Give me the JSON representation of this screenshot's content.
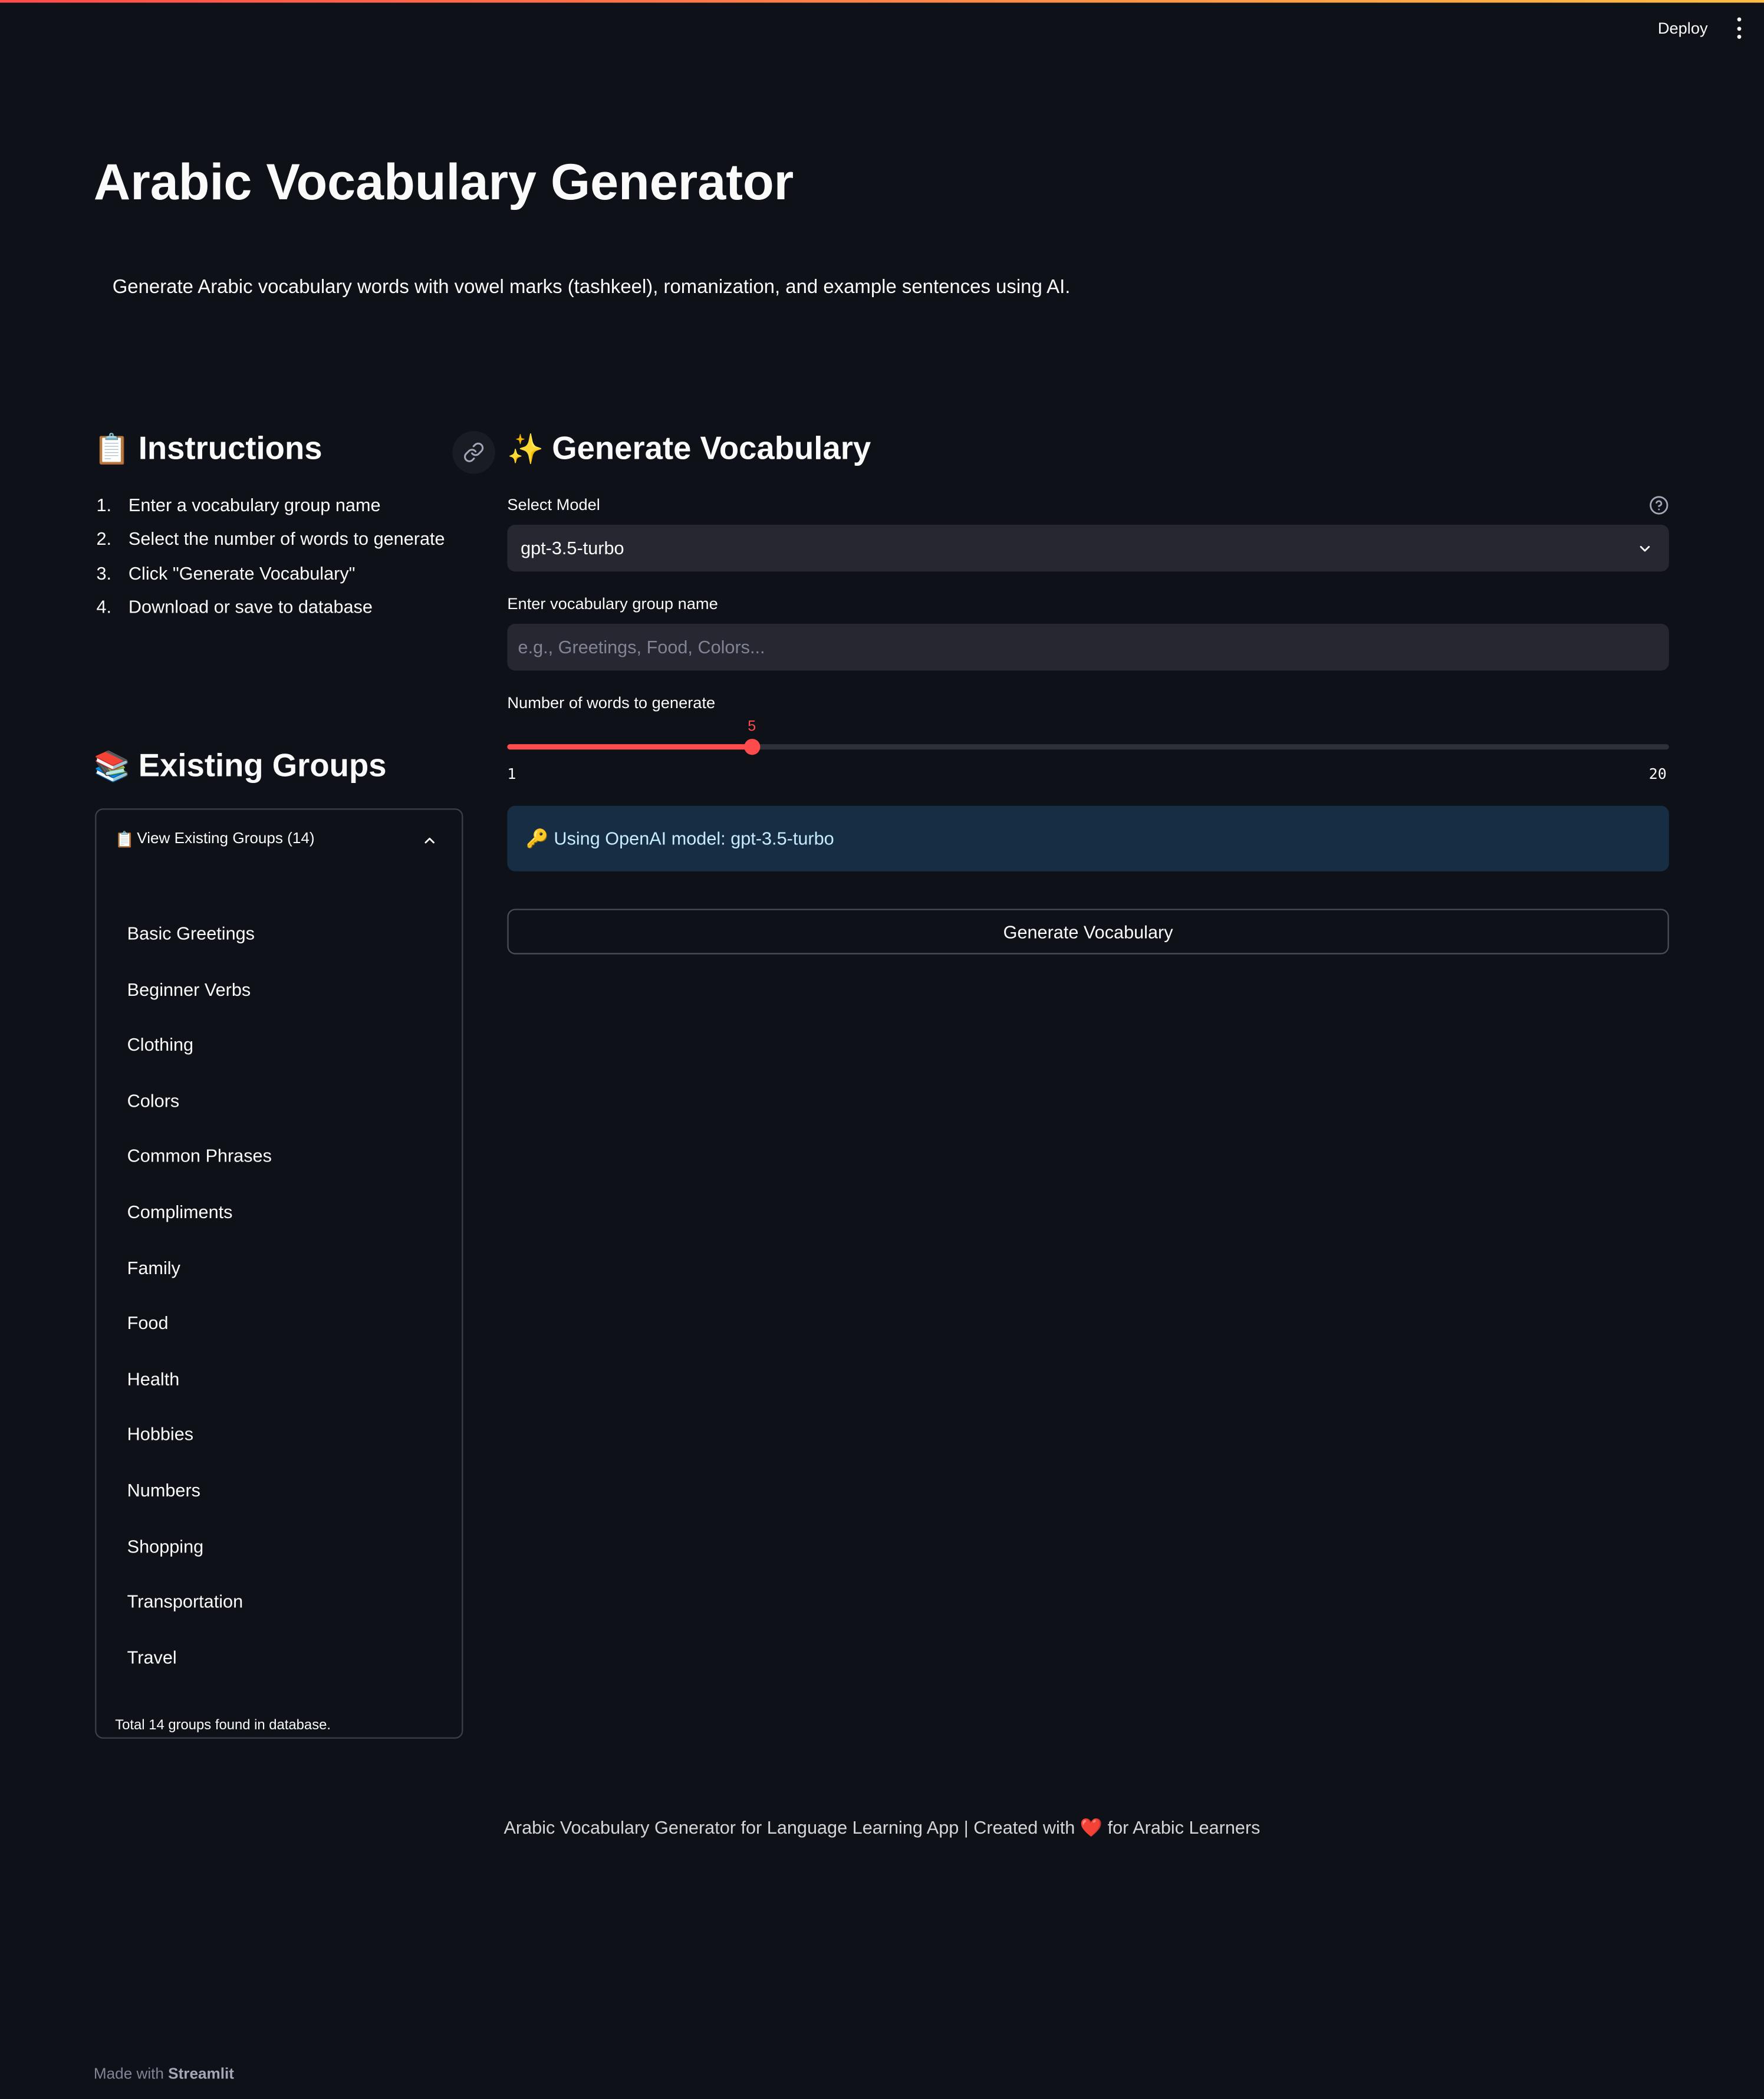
{
  "header": {
    "deploy_label": "Deploy"
  },
  "title": "Arabic Vocabulary Generator",
  "subtitle": "Generate Arabic vocabulary words with vowel marks (tashkeel), romanization, and example sentences using AI.",
  "instructions": {
    "heading": "Instructions",
    "steps": [
      "Enter a vocabulary group name",
      "Select the number of words to generate",
      "Click \"Generate Vocabulary\"",
      "Download or save to database"
    ]
  },
  "existing_groups": {
    "heading": "Existing Groups",
    "expander_label": "View Existing Groups (14)",
    "groups": [
      "Basic Greetings",
      "Beginner Verbs",
      "Clothing",
      "Colors",
      "Common Phrases",
      "Compliments",
      "Family",
      "Food",
      "Health",
      "Hobbies",
      "Numbers",
      "Shopping",
      "Transportation",
      "Travel"
    ],
    "total_text": "Total 14 groups found in database."
  },
  "generate": {
    "heading": "Generate Vocabulary",
    "model_label": "Select Model",
    "model_value": "gpt-3.5-turbo",
    "group_label": "Enter vocabulary group name",
    "group_placeholder": "e.g., Greetings, Food, Colors...",
    "words_label": "Number of words to generate",
    "slider": {
      "value": 5,
      "min": 1,
      "max": 20
    },
    "info_text": "Using OpenAI model: gpt-3.5-turbo",
    "button_label": "Generate Vocabulary"
  },
  "footer": {
    "text_before": "Arabic Vocabulary Generator for Language Learning App | Created with",
    "text_after": "for Arabic Learners"
  },
  "made_with": {
    "prefix": "Made with",
    "brand": "Streamlit"
  },
  "colors": {
    "background": "#0e1117",
    "accent": "#ff4b4b",
    "info_bg": "#172d43",
    "input_bg": "#262730"
  },
  "icons": [
    "clipboard-icon",
    "books-icon",
    "sparkles-icon",
    "link-icon",
    "help-icon",
    "chevron-down-icon",
    "chevron-up-icon",
    "key-icon",
    "heart-icon",
    "kebab-menu-icon"
  ]
}
